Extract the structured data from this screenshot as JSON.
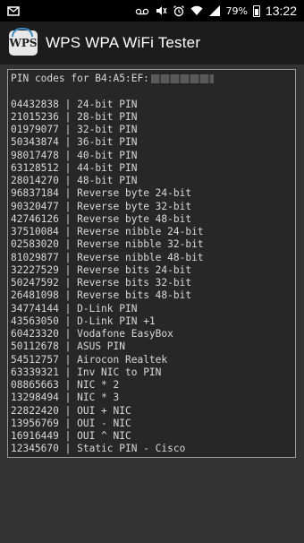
{
  "status_bar": {
    "battery_percent": "79%",
    "time": "13:22",
    "icons": [
      "mail-icon",
      "voicemail-icon",
      "mute-icon",
      "alarm-icon",
      "wifi-icon",
      "signal-icon",
      "battery-icon"
    ]
  },
  "app_bar": {
    "logo_text": "WPS",
    "title": "WPS WPA WiFi Tester"
  },
  "terminal": {
    "header": "PIN codes for B4:A5:EF:",
    "separator": " | ",
    "rows": [
      {
        "pin": "04432838",
        "label": "24-bit PIN"
      },
      {
        "pin": "21015236",
        "label": "28-bit PIN"
      },
      {
        "pin": "01979077",
        "label": "32-bit PIN"
      },
      {
        "pin": "50343874",
        "label": "36-bit PIN"
      },
      {
        "pin": "98017478",
        "label": "40-bit PIN"
      },
      {
        "pin": "63128512",
        "label": "44-bit PIN"
      },
      {
        "pin": "28014270",
        "label": "48-bit PIN"
      },
      {
        "pin": "96837184",
        "label": "Reverse byte 24-bit"
      },
      {
        "pin": "90320477",
        "label": "Reverse byte 32-bit"
      },
      {
        "pin": "42746126",
        "label": "Reverse byte 48-bit"
      },
      {
        "pin": "37510084",
        "label": "Reverse nibble 24-bit"
      },
      {
        "pin": "02583020",
        "label": "Reverse nibble 32-bit"
      },
      {
        "pin": "81029877",
        "label": "Reverse nibble 48-bit"
      },
      {
        "pin": "32227529",
        "label": "Reverse bits 24-bit"
      },
      {
        "pin": "50247592",
        "label": "Reverse bits 32-bit"
      },
      {
        "pin": "26481098",
        "label": "Reverse bits 48-bit"
      },
      {
        "pin": "34774144",
        "label": "D-Link PIN"
      },
      {
        "pin": "43563050",
        "label": "D-Link PIN +1"
      },
      {
        "pin": "60423320",
        "label": "Vodafone EasyBox"
      },
      {
        "pin": "50112678",
        "label": "ASUS PIN"
      },
      {
        "pin": "54512757",
        "label": "Airocon Realtek"
      },
      {
        "pin": "63339321",
        "label": "Inv NIC to PIN"
      },
      {
        "pin": "08865663",
        "label": "NIC * 2"
      },
      {
        "pin": "13298494",
        "label": "NIC * 3"
      },
      {
        "pin": "22822420",
        "label": "OUI + NIC"
      },
      {
        "pin": "13956769",
        "label": "OUI - NIC"
      },
      {
        "pin": "16916449",
        "label": "OUI ^ NIC"
      },
      {
        "pin": "12345670",
        "label": "Static PIN - Cisco"
      }
    ]
  }
}
